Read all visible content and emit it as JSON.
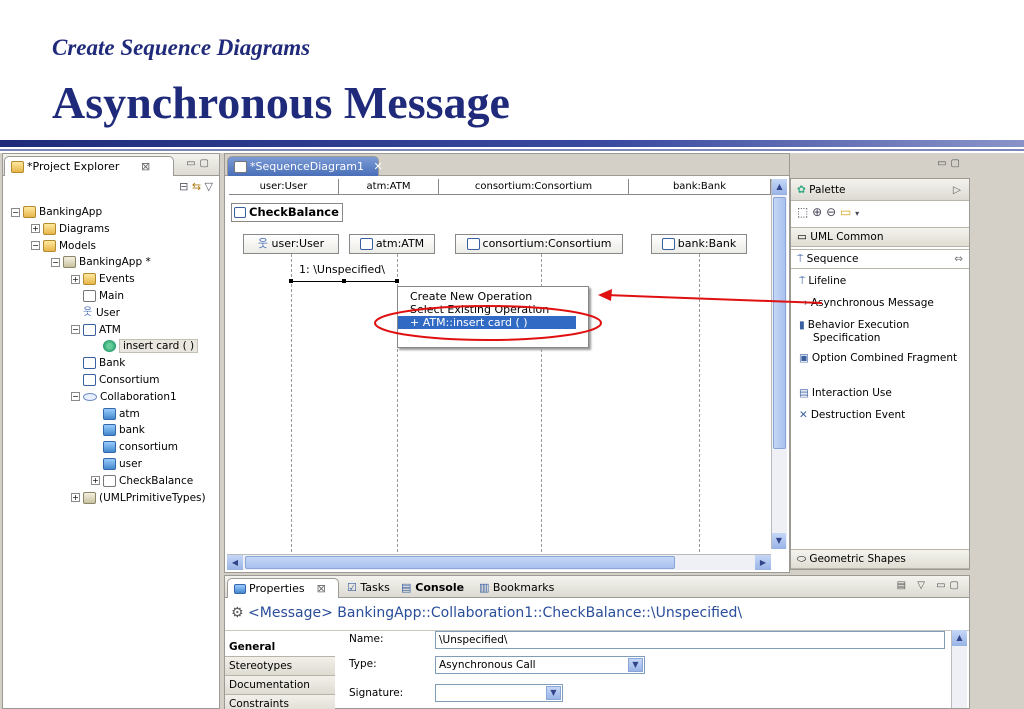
{
  "slide": {
    "subtitle": "Create Sequence Diagrams",
    "title": "Asynchronous Message"
  },
  "project_explorer": {
    "tab_label": "*Project Explorer",
    "tree": [
      {
        "label": "BankingApp",
        "icon": "project-icon",
        "level": 0,
        "expander": "−"
      },
      {
        "label": "Diagrams",
        "icon": "package-icon",
        "level": 1,
        "expander": "+"
      },
      {
        "label": "Models",
        "icon": "package-icon",
        "level": 1,
        "expander": "−"
      },
      {
        "label": "BankingApp *",
        "icon": "model-icon",
        "level": 2,
        "expander": "−"
      },
      {
        "label": "Events",
        "icon": "package-icon",
        "level": 3,
        "expander": "+"
      },
      {
        "label": "Main",
        "icon": "diagram-icon",
        "level": 3,
        "expander": ""
      },
      {
        "label": "User",
        "icon": "actor-icon",
        "level": 3,
        "expander": ""
      },
      {
        "label": "ATM",
        "icon": "class-icon",
        "level": 3,
        "expander": "−"
      },
      {
        "label": "insert card ( )",
        "icon": "operation-icon",
        "level": 4,
        "expander": "",
        "selected": true
      },
      {
        "label": "Bank",
        "icon": "class-icon",
        "level": 3,
        "expander": ""
      },
      {
        "label": "Consortium",
        "icon": "class-icon",
        "level": 3,
        "expander": ""
      },
      {
        "label": "Collaboration1",
        "icon": "collaboration-icon",
        "level": 3,
        "expander": "−"
      },
      {
        "label": "atm",
        "icon": "property-icon",
        "level": 4,
        "expander": ""
      },
      {
        "label": "bank",
        "icon": "property-icon",
        "level": 4,
        "expander": ""
      },
      {
        "label": "consortium",
        "icon": "property-icon",
        "level": 4,
        "expander": ""
      },
      {
        "label": "user",
        "icon": "property-icon",
        "level": 4,
        "expander": ""
      },
      {
        "label": "CheckBalance",
        "icon": "interaction-icon",
        "level": 4,
        "expander": "+"
      },
      {
        "label": "(UMLPrimitiveTypes)",
        "icon": "library-icon",
        "level": 3,
        "expander": "+"
      }
    ]
  },
  "editor": {
    "tab_label": "*SequenceDiagram1",
    "ruler": [
      "user:User",
      "atm:ATM",
      "consortium:Consortium",
      "bank:Bank"
    ],
    "frame_label": "CheckBalance",
    "lifelines": [
      "user:User",
      "atm:ATM",
      "consortium:Consortium",
      "bank:Bank"
    ],
    "message_label": "1: \\Unspecified\\",
    "context_menu": [
      "Create New Operation",
      "Select Existing Operation",
      "+ ATM::insert card ( )"
    ]
  },
  "palette": {
    "title": "Palette",
    "drawers": [
      "UML Common",
      "Sequence",
      "Geometric Shapes"
    ],
    "tools": [
      "Lifeline",
      "Asynchronous Message",
      "Behavior Execution Specification",
      "Option Combined Fragment",
      "Interaction Use",
      "Destruction Event"
    ]
  },
  "bottom": {
    "tabs": [
      "Properties",
      "Tasks",
      "Console",
      "Bookmarks"
    ],
    "element_title": "<Message> BankingApp::Collaboration1::CheckBalance::\\Unspecified\\",
    "prop_tabs": [
      "General",
      "Stereotypes",
      "Documentation",
      "Constraints"
    ],
    "fields": {
      "name_label": "Name:",
      "name_value": "\\Unspecified\\",
      "type_label": "Type:",
      "type_value": "Asynchronous Call",
      "signature_label": "Signature:",
      "signature_value": ""
    }
  },
  "colors": {
    "title_blue": "#1f2a7a",
    "annotation_red": "#e01010",
    "selection_blue": "#316ac5"
  }
}
